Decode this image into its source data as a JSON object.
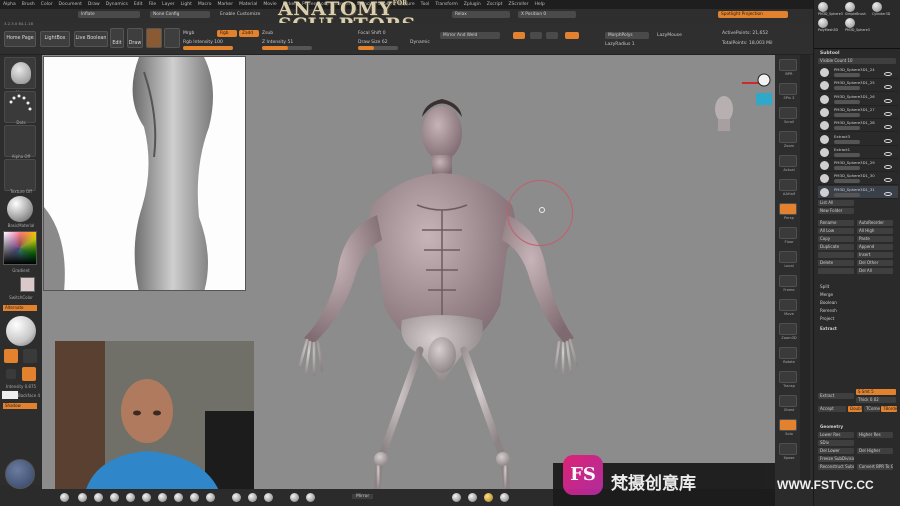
{
  "menu": [
    "Alpha",
    "Brush",
    "Color",
    "Document",
    "Draw",
    "Dynamics",
    "Edit",
    "File",
    "Layer",
    "Light",
    "Macro",
    "Marker",
    "Material",
    "Movie",
    "Picker",
    "Preferences",
    "Render",
    "Stencil",
    "Stroke",
    "Texture",
    "Tool",
    "Transform",
    "Zplugin",
    "Zscript",
    "ZScroller",
    "Help"
  ],
  "top_info": {
    "infilate": "Inflate",
    "none_config": "None Config",
    "enable_customize": "Enable Customize",
    "mirror_weld": "Mirror And Weld",
    "spotlight_projection": "Spotlight Projection",
    "relax": "Relax",
    "xposition": "X Position 0",
    "version": "3.2.3.0 84.1.18"
  },
  "logo": {
    "line1": "ANATOMY",
    "for": "FOR",
    "line2": "SCULPTORS"
  },
  "toolbar": {
    "home_page": "Home Page",
    "lightbox": "LightBox",
    "live_boolean": "Live Boolean",
    "edit": "Edit",
    "draw": "Draw",
    "mrgb": "Mrgb",
    "rgb": "Rgb",
    "m": "M",
    "zadd": "Zadd",
    "zsub": "Zsub",
    "zcut": "Zcut",
    "rgb_intensity": "Rgb Intensity 100",
    "z_intensity": "Z Intensity 51",
    "focal_shift": "Focal Shift 0",
    "draw_size": "Draw Size 62",
    "dynamic": "Dynamic",
    "mirror_weld": "Mirror And Weld",
    "lazy_mouse": "LazyMouse",
    "morph_polys": "MorphPolys",
    "lazy_radius": "LazyRadius 1",
    "active_points": "ActivePoints: 21,652",
    "total_points": "TotalPoints: 18,003 Mil"
  },
  "left_shelf": {
    "move": "Move",
    "dots": "Dots",
    "alpha_off": "Alpha Off",
    "texture_off": "Texture Off",
    "basic_material": "BasicMaterial",
    "gradient": "Gradient",
    "switch_color": "SwitchColor",
    "alternate": "Alternate",
    "intensity": "Intensity 0.875",
    "backface": "Backface 4",
    "shadow": "Shadow"
  },
  "right_shelf": [
    "BPR",
    "SPix 3",
    "Scroll",
    "Zoom",
    "Actual",
    "AAHalf",
    "Persp",
    "Floor",
    "Local",
    "Frame",
    "Move",
    "Zoom3D",
    "Rotate",
    "Transp",
    "Ghost",
    "Solo",
    "Xpose"
  ],
  "tray": {
    "top_tools": [
      "PM3D_Sphere3",
      "SimpleBrush",
      "Cylinder3D",
      "PolyMesh3D",
      "PM3D_Sphere3"
    ],
    "subtool_title": "Subtool",
    "visible_count": "Visible Count 10",
    "subtools": [
      {
        "name": "PM3D_Sphere3D1_24"
      },
      {
        "name": "PM3D_Sphere3D1_25"
      },
      {
        "name": "PM3D_Sphere3D1_26"
      },
      {
        "name": "PM3D_Sphere3D1_27"
      },
      {
        "name": "PM3D_Sphere3D1_28"
      },
      {
        "name": "Extract3"
      },
      {
        "name": "Extract1"
      },
      {
        "name": "PM3D_Sphere3D1_29"
      },
      {
        "name": "PM3D_Sphere3D1_30"
      },
      {
        "name": "PM3D_Sphere3D1_31"
      }
    ],
    "list_all": "List All",
    "new_folder": "New Folder",
    "actions": [
      [
        "Rename",
        "AutoReorder"
      ],
      [
        "All Low",
        "All High"
      ],
      [
        "Copy",
        "Paste"
      ],
      [
        "Duplicate",
        "Append"
      ],
      [
        "",
        "Insert"
      ],
      [
        "Delete",
        "Del Other"
      ],
      [
        "",
        "Del All"
      ]
    ],
    "split": "Split",
    "merge": "Merge",
    "boolean": "Boolean",
    "remesh": "Remesh",
    "project": "Project",
    "extract_title": "Extract",
    "s_smt": "S Smt 5",
    "thick": "Thick 0.02",
    "extract_btn": "Extract",
    "accept_btn": "Accept",
    "double": "Double",
    "tcorner": "TCorner",
    "tborder": "TBorder",
    "geometry_title": "Geometry",
    "geo": [
      [
        "Lower Res",
        "Higher Res"
      ],
      [
        "SDiv",
        ""
      ],
      [
        "Del Lower",
        "Del Higher"
      ],
      [
        "Freeze SubDivision Levels",
        ""
      ],
      [
        "Reconstruct Subdiv",
        "Convert BPR To Geo"
      ]
    ]
  },
  "bottom": {
    "mirror": "Mirror"
  },
  "watermark": {
    "logo": "FS",
    "text": "梵摄创意库",
    "url": "WWW.FSTVC.CC"
  }
}
